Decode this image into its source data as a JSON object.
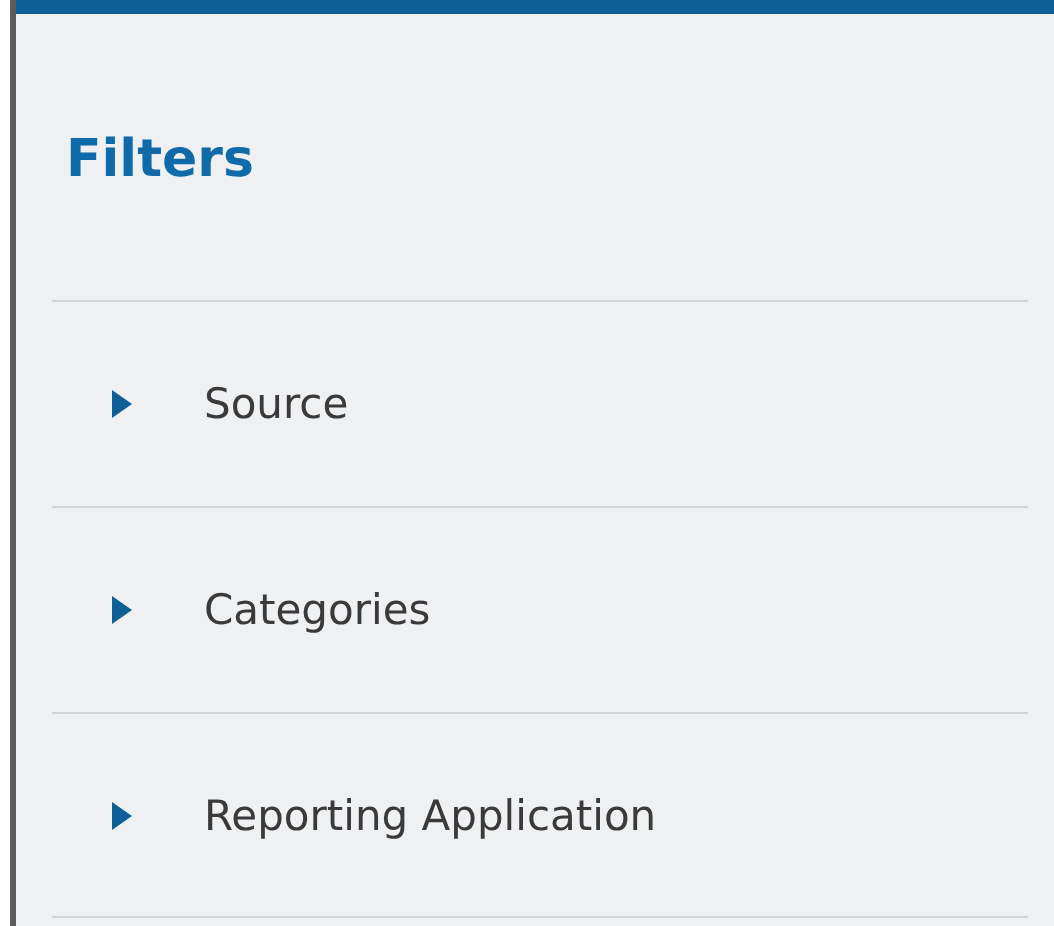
{
  "panel": {
    "title": "Filters"
  },
  "sections": [
    {
      "label": "Source",
      "expanded": false
    },
    {
      "label": "Categories",
      "expanded": false
    },
    {
      "label": "Reporting Application",
      "expanded": false
    }
  ]
}
